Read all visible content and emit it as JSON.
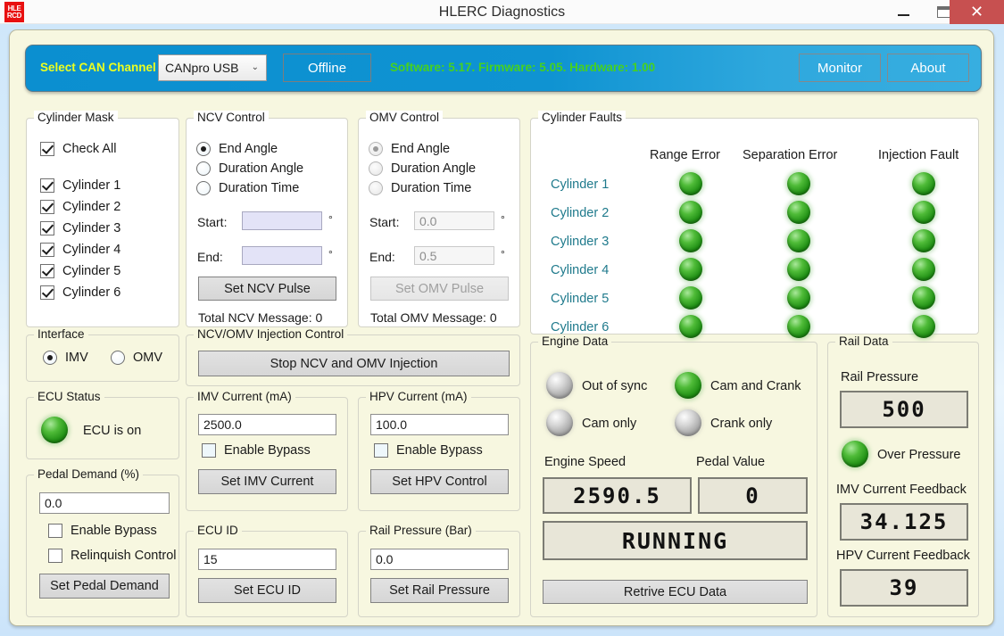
{
  "window": {
    "title": "HLERC Diagnostics",
    "logo_line1": "HLE",
    "logo_line2": "RCD",
    "minimize_icon": "minimize-icon",
    "maximize_icon": "maximize-icon",
    "close_icon": "✕"
  },
  "header": {
    "can_channel_label": "Select CAN Channel",
    "can_channel_value": "CANpro USB",
    "chevron": "⌄",
    "offline_label": "Offline",
    "version_text": "Software: 5.17. Firmware: 5.05. Hardware: 1.00",
    "monitor_label": "Monitor",
    "about_label": "About",
    "label_color": "#ecff1f",
    "version_color": "#46d120"
  },
  "cylinder_mask": {
    "legend": "Cylinder Mask",
    "check_all": "Check All",
    "items": [
      {
        "label": "Cylinder 1",
        "checked": true
      },
      {
        "label": "Cylinder 2",
        "checked": true
      },
      {
        "label": "Cylinder 3",
        "checked": true
      },
      {
        "label": "Cylinder 4",
        "checked": true
      },
      {
        "label": "Cylinder 5",
        "checked": true
      },
      {
        "label": "Cylinder 6",
        "checked": true
      }
    ]
  },
  "ncv_control": {
    "legend": "NCV Control",
    "modes": [
      "End Angle",
      "Duration Angle",
      "Duration Time"
    ],
    "selected_mode": "End Angle",
    "start_label": "Start:",
    "start_value": "",
    "end_label": "End:",
    "end_value": "",
    "unit": "°",
    "button": "Set NCV Pulse",
    "total_message": "Total NCV Message: 0"
  },
  "omv_control": {
    "legend": "OMV Control",
    "modes": [
      "End Angle",
      "Duration Angle",
      "Duration Time"
    ],
    "selected_mode": "End Angle",
    "start_label": "Start:",
    "start_value": "0.0",
    "end_label": "End:",
    "end_value": "0.5",
    "unit": "°",
    "button": "Set OMV Pulse",
    "total_message": "Total OMV Message: 0"
  },
  "cylinder_faults": {
    "legend": "Cylinder Faults",
    "columns": [
      "Range Error",
      "Separation Error",
      "Injection Fault"
    ],
    "rows": [
      {
        "label": "Cylinder 1",
        "range_error": "green",
        "separation_error": "green",
        "injection_fault": "green"
      },
      {
        "label": "Cylinder 2",
        "range_error": "green",
        "separation_error": "green",
        "injection_fault": "green"
      },
      {
        "label": "Cylinder 3",
        "range_error": "green",
        "separation_error": "green",
        "injection_fault": "green"
      },
      {
        "label": "Cylinder 4",
        "range_error": "green",
        "separation_error": "green",
        "injection_fault": "green"
      },
      {
        "label": "Cylinder 5",
        "range_error": "green",
        "separation_error": "green",
        "injection_fault": "green"
      },
      {
        "label": "Cylinder 6",
        "range_error": "green",
        "separation_error": "green",
        "injection_fault": "green"
      }
    ]
  },
  "interface": {
    "legend": "Interface",
    "options": [
      "IMV",
      "OMV"
    ],
    "selected": "IMV"
  },
  "ecu_status": {
    "legend": "ECU Status",
    "led": "green",
    "text": "ECU is on"
  },
  "pedal_demand": {
    "legend": "Pedal Demand (%)",
    "value": "0.0",
    "enable_bypass": "Enable Bypass",
    "enable_bypass_checked": false,
    "relinquish_control": "Relinquish Control",
    "relinquish_checked": false,
    "button": "Set Pedal Demand"
  },
  "injection_control": {
    "legend": "NCV/OMV Injection Control",
    "button": "Stop NCV and OMV Injection"
  },
  "imv_current": {
    "legend": "IMV Current (mA)",
    "value": "2500.0",
    "enable_bypass": "Enable Bypass",
    "enable_bypass_checked": false,
    "button": "Set IMV Current"
  },
  "hpv_current": {
    "legend": "HPV Current (mA)",
    "value": "100.0",
    "enable_bypass": "Enable Bypass",
    "enable_bypass_checked": false,
    "button": "Set HPV Control"
  },
  "ecu_id": {
    "legend": "ECU ID",
    "value": "15",
    "button": "Set ECU ID"
  },
  "rail_pressure_input": {
    "legend": "Rail Pressure (Bar)",
    "value": "0.0",
    "button": "Set Rail Pressure"
  },
  "engine_data": {
    "legend": "Engine Data",
    "indicators": [
      {
        "label": "Out of sync",
        "led": "grey"
      },
      {
        "label": "Cam and Crank",
        "led": "green"
      },
      {
        "label": "Cam only",
        "led": "grey"
      },
      {
        "label": "Crank only",
        "led": "grey"
      }
    ],
    "engine_speed_label": "Engine Speed",
    "engine_speed_value": "2590.5",
    "pedal_value_label": "Pedal Value",
    "pedal_value_value": "0",
    "status_value": "RUNNING",
    "button": "Retrive ECU Data"
  },
  "rail_data": {
    "legend": "Rail Data",
    "rail_pressure_label": "Rail Pressure",
    "rail_pressure_value": "500",
    "over_pressure_label": "Over Pressure",
    "over_pressure_led": "green",
    "imv_feedback_label": "IMV Current Feedback",
    "imv_feedback_value": "34.125",
    "hpv_feedback_label": "HPV Current Feedback",
    "hpv_feedback_value": "39"
  }
}
